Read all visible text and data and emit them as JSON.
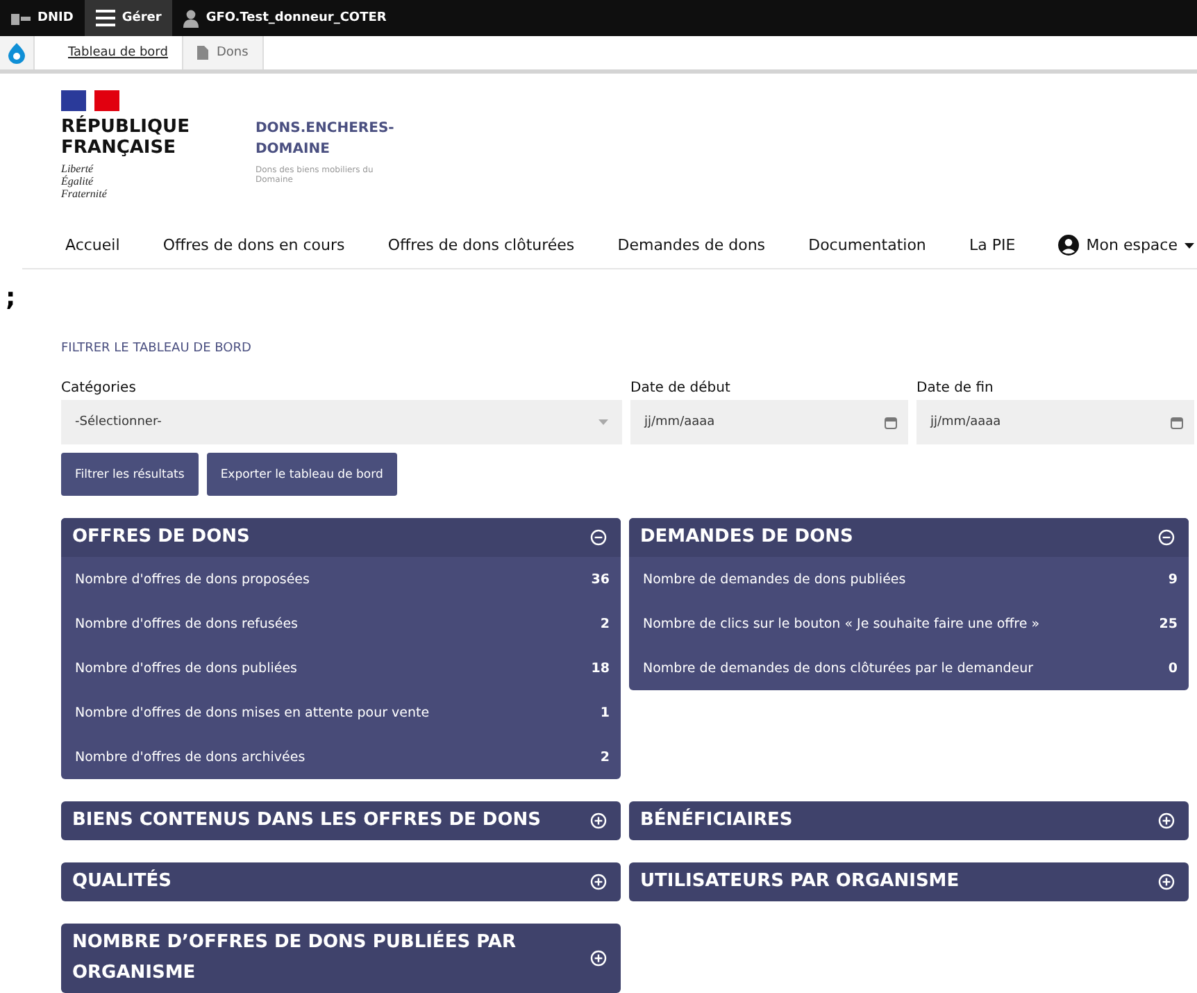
{
  "admin_bar": {
    "site": "DNID",
    "manage": "Gérer",
    "user": "GFO.Test_donneur_COTER"
  },
  "admin_tabs": [
    {
      "label": "Tableau de bord",
      "selected": true
    },
    {
      "label": "Dons",
      "selected": false
    }
  ],
  "brand": {
    "republic": "RÉPUBLIQUE FRANÇAISE",
    "motto": [
      "Liberté",
      "Égalité",
      "Fraternité"
    ],
    "site_title": "DONS.ENCHERES-DOMAINE",
    "tagline": "Dons des biens mobiliers du Domaine"
  },
  "nav": [
    "Accueil",
    "Offres de dons en cours",
    "Offres de dons clôturées",
    "Demandes de dons",
    "Documentation",
    "La PIE"
  ],
  "account": "Mon espace",
  "stray_mark": ";",
  "filter": {
    "title": "FILTRER LE TABLEAU DE BORD",
    "categories_label": "Catégories",
    "categories_value": "-Sélectionner-",
    "start_label": "Date de début",
    "start_placeholder": "jj/mm/aaaa",
    "end_label": "Date de fin",
    "end_placeholder": "jj/mm/aaaa",
    "buttons": [
      "Filtrer les résultats",
      "Exporter le tableau de bord"
    ]
  },
  "panels": [
    {
      "title": "OFFRES DE DONS",
      "expanded": true,
      "rows": [
        {
          "label": "Nombre d'offres de dons proposées",
          "value": "36"
        },
        {
          "label": "Nombre d'offres de dons refusées",
          "value": "2"
        },
        {
          "label": "Nombre d'offres de dons publiées",
          "value": "18"
        },
        {
          "label": "Nombre d'offres de dons mises en attente pour vente",
          "value": "1"
        },
        {
          "label": "Nombre d'offres de dons archivées",
          "value": "2"
        }
      ]
    },
    {
      "title": "DEMANDES DE DONS",
      "expanded": true,
      "rows": [
        {
          "label": "Nombre de demandes de dons publiées",
          "value": "9"
        },
        {
          "label": "Nombre de clics sur le bouton « Je souhaite faire une offre »",
          "value": "25"
        },
        {
          "label": "Nombre de demandes de dons clôturées par le demandeur",
          "value": "0"
        }
      ]
    },
    {
      "title": "BIENS CONTENUS DANS LES OFFRES DE DONS",
      "expanded": false
    },
    {
      "title": "BÉNÉFICIAIRES",
      "expanded": false
    },
    {
      "title": "QUALITÉS",
      "expanded": false
    },
    {
      "title": "UTILISATEURS PAR ORGANISME",
      "expanded": false
    },
    {
      "title": "NOMBRE D’OFFRES DE DONS PUBLIÉES PAR ORGANISME",
      "expanded": false
    }
  ]
}
